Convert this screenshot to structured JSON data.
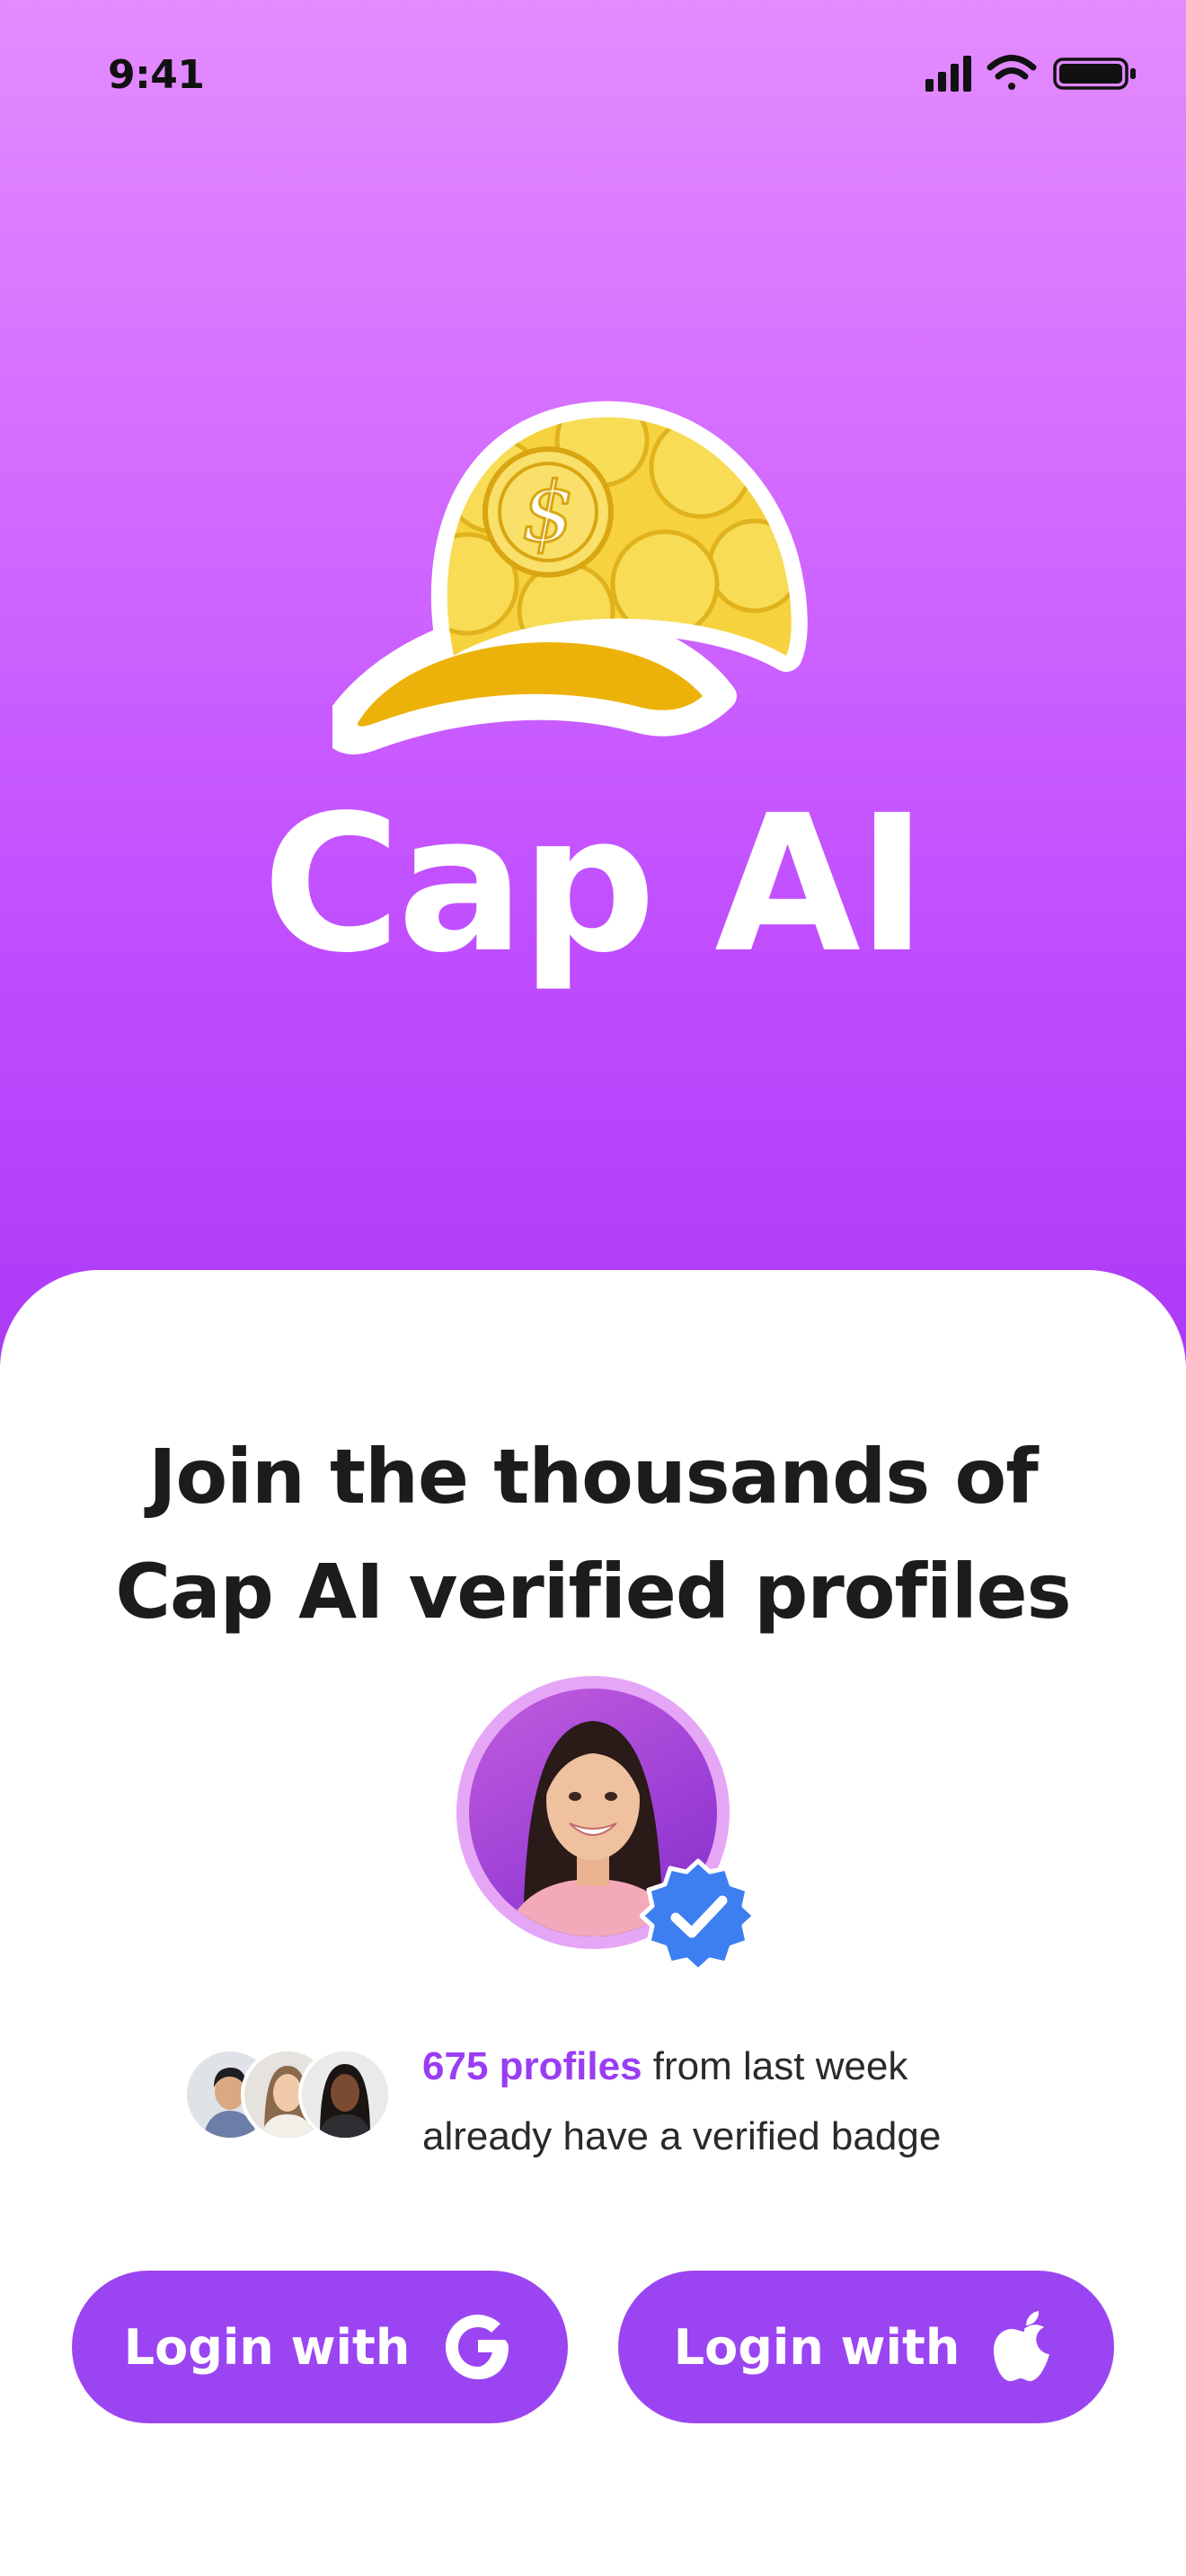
{
  "status_bar": {
    "time": "9:41",
    "icons": [
      "signal-icon",
      "wifi-icon",
      "battery-icon"
    ]
  },
  "hero": {
    "logo": "gold-coin-cap-logo",
    "app_name": "Cap AI"
  },
  "onboarding": {
    "headline_line1": "Join the thousands of",
    "headline_line2": "Cap AI verified profiles",
    "profile_badge": "verified-badge-icon",
    "social_proof": {
      "count_text": "675 profiles",
      "rest_line1": " from last week",
      "line2": "already have a verified badge"
    }
  },
  "actions": {
    "google_label": "Login with",
    "apple_label": "Login with"
  },
  "colors": {
    "accent": "#9b45f2",
    "hero_top": "#e38cff",
    "hero_bottom": "#ac3af6",
    "verified_blue": "#3d7ff0",
    "cap_gold": "#ecb20a"
  }
}
